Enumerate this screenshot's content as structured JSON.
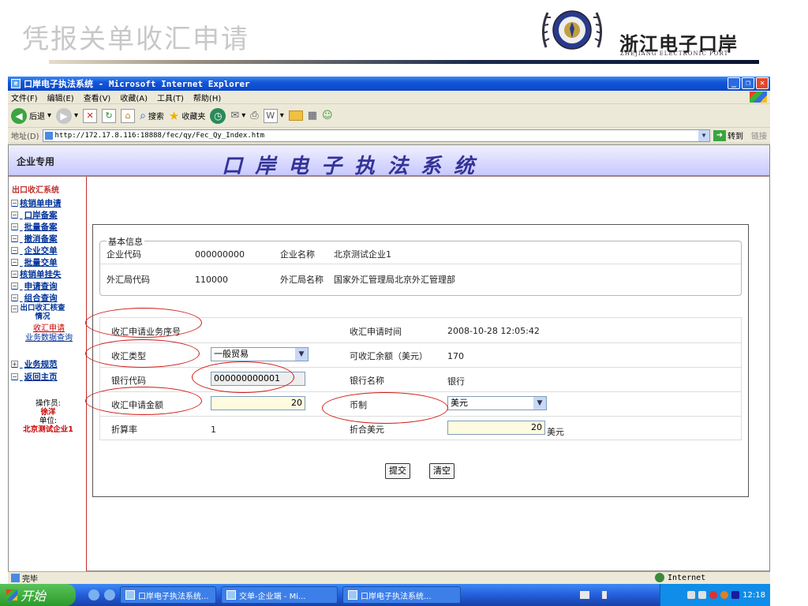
{
  "slide": {
    "title": "凭报关单收汇申请",
    "logo_cn": "浙江电子口岸",
    "logo_en": "ZHEJIANG ELECTRONIC PORT"
  },
  "window": {
    "title": "口岸电子执法系统 - Microsoft Internet Explorer",
    "menus": [
      "文件(F)",
      "编辑(E)",
      "查看(V)",
      "收藏(A)",
      "工具(T)",
      "帮助(H)"
    ],
    "toolbar": {
      "back": "后退",
      "search": "搜索",
      "favorites": "收藏夹"
    },
    "address_label": "地址(D)",
    "address_url": "http://172.17.8.116:18888/fec/qy/Fec_Qy_Index.htm",
    "go_label": "转到",
    "links_label": "链接",
    "status_text": "完毕",
    "zone_text": "Internet"
  },
  "app": {
    "enterprise_label": "企业专用",
    "system_title": "口岸电子执法系统"
  },
  "sidebar": {
    "heading": "出口收汇系统",
    "items": [
      {
        "label": "核销单申请"
      },
      {
        "label": "口岸备案"
      },
      {
        "label": "批量备案"
      },
      {
        "label": "撤消备案"
      },
      {
        "label": "企业交单"
      },
      {
        "label": "批量交单"
      },
      {
        "label": "核销单挂失"
      },
      {
        "label": "申请查询"
      },
      {
        "label": "组合查询"
      },
      {
        "label": "出口收汇核查情况"
      },
      {
        "label": "业务规范"
      },
      {
        "label": "返回主页"
      }
    ],
    "sub_items": [
      {
        "label": "收汇申请"
      },
      {
        "label": "业务数据查询"
      }
    ],
    "operator_label": "操作员:",
    "operator_name": "徐洋",
    "unit_label": "单位:",
    "unit_name": "北京测试企业1"
  },
  "basic_info": {
    "legend": "基本信息",
    "enterprise_code_label": "企业代码",
    "enterprise_code": "000000000",
    "enterprise_name_label": "企业名称",
    "enterprise_name": "北京测试企业1",
    "bureau_code_label": "外汇局代码",
    "bureau_code": "110000",
    "bureau_name_label": "外汇局名称",
    "bureau_name": "国家外汇管理局北京外汇管理部"
  },
  "form": {
    "seq_label": "收汇申请业务序号",
    "seq_value": "",
    "time_label": "收汇申请时间",
    "time_value": "2008-10-28 12:05:42",
    "type_label": "收汇类型",
    "type_value": "一般贸易",
    "balance_label": "可收汇余额（美元）",
    "balance_value": "170",
    "bank_code_label": "银行代码",
    "bank_code_value": "000000000001",
    "bank_name_label": "银行名称",
    "bank_name_value": "银行",
    "amount_label": "收汇申请金额",
    "amount_value": "20",
    "currency_label": "币制",
    "currency_value": "美元",
    "rate_label": "折算率",
    "rate_value": "1",
    "usd_label": "折合美元",
    "usd_value": "20",
    "usd_unit": "美元",
    "submit_label": "提交",
    "clear_label": "清空"
  },
  "taskbar": {
    "start_label": "开始",
    "tasks": [
      {
        "label": "口岸电子执法系统..."
      },
      {
        "label": "交单-企业端 - Mi..."
      },
      {
        "label": "口岸电子执法系统..."
      }
    ],
    "clock": "12:18"
  },
  "colors": {
    "annotation": "#d01818",
    "sidebar_link": "#003399",
    "xp_blue": "#245edb"
  }
}
